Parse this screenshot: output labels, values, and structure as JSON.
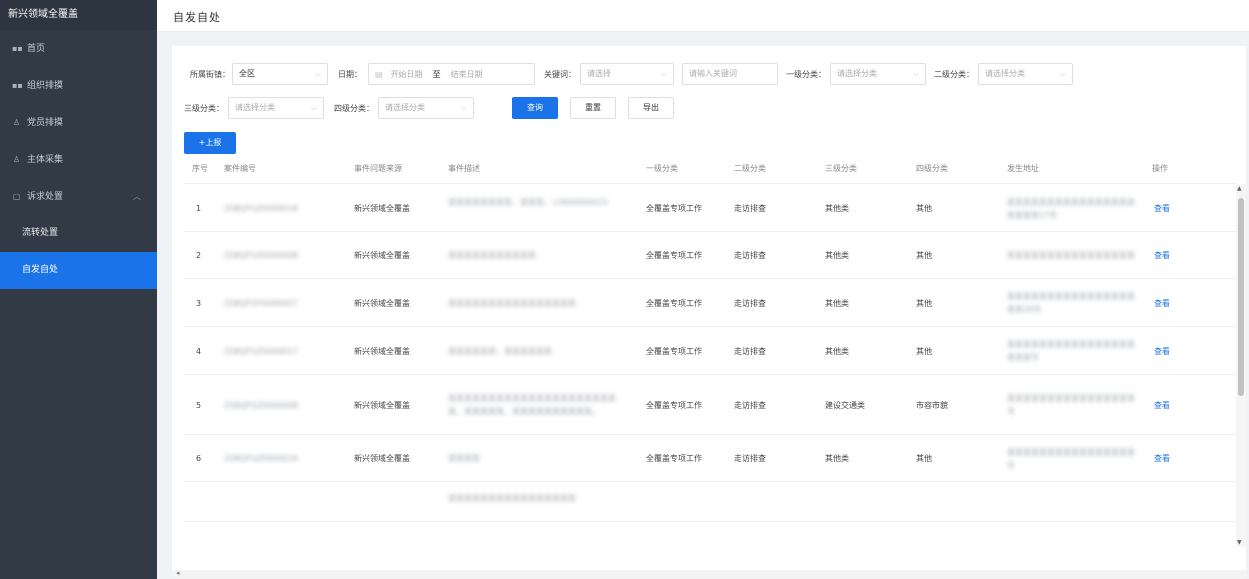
{
  "sidebar": {
    "brand": "新兴领域全覆盖",
    "items": [
      {
        "label": "首页",
        "icon": "grid-icon"
      },
      {
        "label": "组织排摸",
        "icon": "grid-icon"
      },
      {
        "label": "党员排摸",
        "icon": "user-icon"
      },
      {
        "label": "主体采集",
        "icon": "user-icon"
      },
      {
        "label": "诉求处置",
        "icon": "doc-icon"
      }
    ],
    "subitems": [
      {
        "label": "流转处置"
      },
      {
        "label": "自发自处"
      }
    ]
  },
  "header": {
    "title": "自发自处"
  },
  "filters": {
    "area_label": "所属街镇：",
    "area_value": "全区",
    "date_label": "日期：",
    "date_start_placeholder": "开始日期",
    "date_sep": "至",
    "date_end_placeholder": "结束日期",
    "keyword_label": "关键词：",
    "keyword_select_placeholder": "请选择",
    "keyword_input_placeholder": "请输入关键词",
    "cat1_label": "一级分类：",
    "cat1_placeholder": "请选择分类",
    "cat2_label": "二级分类：",
    "cat2_placeholder": "请选择分类",
    "cat3_label": "三级分类：",
    "cat3_placeholder": "请选择分类",
    "cat4_label": "四级分类：",
    "cat4_placeholder": "请选择分类"
  },
  "buttons": {
    "query": "查询",
    "reset": "重置",
    "export": "导出",
    "report": "+上报"
  },
  "table": {
    "columns": [
      "序号",
      "案件编号",
      "事件问题来源",
      "事件描述",
      "一级分类",
      "二级分类",
      "三级分类",
      "四级分类",
      "发生地址",
      "操作"
    ],
    "rows": [
      {
        "no": "1",
        "case_id": "ZSBQFGZ0000018",
        "source": "新兴领域全覆盖",
        "desc": "某某某某某某某某，某某某，13900000015",
        "cat1": "全覆盖专项工作",
        "cat2": "走访排查",
        "cat3": "其他类",
        "cat4": "其他",
        "address": "某某某某某某某某某某某某某某某某某某某某17号",
        "action": "查看"
      },
      {
        "no": "2",
        "case_id": "ZSBQFGX0000008",
        "source": "新兴领域全覆盖",
        "desc": "某某某某某某某某某某某",
        "cat1": "全覆盖专项工作",
        "cat2": "走访排查",
        "cat3": "其他类",
        "cat4": "其他",
        "address": "某某某某某某某某某某某某某某某某",
        "action": "查看"
      },
      {
        "no": "3",
        "case_id": "ZSBQFGY0000007",
        "source": "新兴领域全覆盖",
        "desc": "某某某某某某某某某某某某某某某某",
        "cat1": "全覆盖专项工作",
        "cat2": "走访排查",
        "cat3": "其他类",
        "cat4": "其他",
        "address": "某某某某某某某某某某某某某某某某某某26号",
        "action": "查看"
      },
      {
        "no": "4",
        "case_id": "ZSBQFGZ0000017",
        "source": "新兴领域全覆盖",
        "desc": "某某某某某某，某某某某某某",
        "cat1": "全覆盖专项工作",
        "cat2": "走访排查",
        "cat3": "其他类",
        "cat4": "其他",
        "address": "某某某某某某某某某某某某某某某某某某某号",
        "action": "查看"
      },
      {
        "no": "5",
        "case_id": "ZSBQFGZ0000008",
        "source": "新兴领域全覆盖",
        "desc": "某某某某某某某某某某某某某某某某某某某某某某，某某某某某，某某某某某某某某某某。",
        "cat1": "全覆盖专项工作",
        "cat2": "走访排查",
        "cat3": "建设交通类",
        "cat4": "市容市貌",
        "address": "某某某某某某某某某某某某某某某某号",
        "action": "查看"
      },
      {
        "no": "6",
        "case_id": "ZSBQFGZ0000016",
        "source": "新兴领域全覆盖",
        "desc": "某某某某",
        "cat1": "全覆盖专项工作",
        "cat2": "走访排查",
        "cat3": "其他类",
        "cat4": "其他",
        "address": "某某某某某某某某某某某某某某某某号",
        "action": "查看"
      },
      {
        "no": "",
        "case_id": "",
        "source": "",
        "desc": "某某某某某某某某某某某某某某某某",
        "cat1": "",
        "cat2": "",
        "cat3": "",
        "cat4": "",
        "address": "",
        "action": ""
      }
    ]
  }
}
